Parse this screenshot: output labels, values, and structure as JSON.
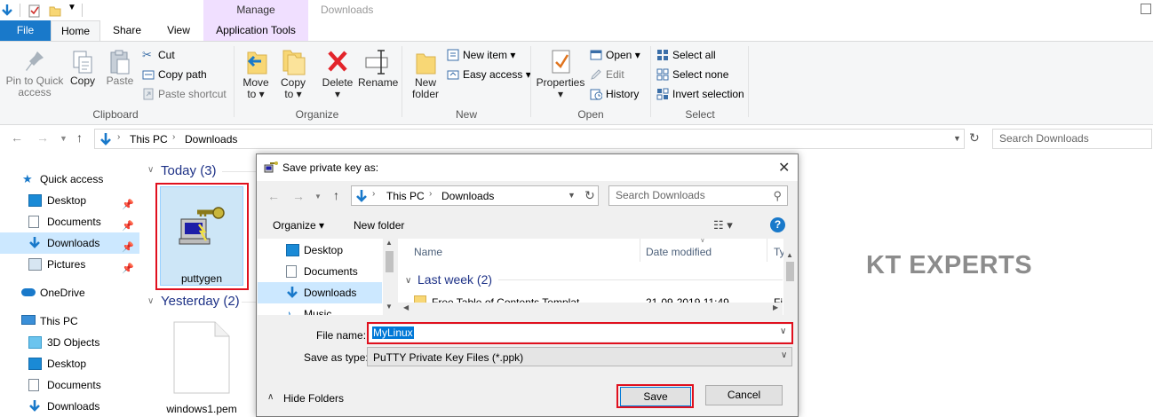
{
  "window": {
    "title": "Downloads",
    "contextual_tab_group": "Manage"
  },
  "tabs": {
    "file": "File",
    "home": "Home",
    "share": "Share",
    "view": "View",
    "app_tools": "Application Tools"
  },
  "ribbon": {
    "clipboard": {
      "group_label": "Clipboard",
      "pin_line1": "Pin to Quick",
      "pin_line2": "access",
      "copy": "Copy",
      "paste": "Paste",
      "cut": "Cut",
      "copy_path": "Copy path",
      "paste_shortcut": "Paste shortcut"
    },
    "organize": {
      "group_label": "Organize",
      "move_line1": "Move",
      "move_line2": "to ▾",
      "copy_line1": "Copy",
      "copy_line2": "to ▾",
      "delete_line1": "Delete",
      "delete_line2": "▾",
      "rename": "Rename"
    },
    "new": {
      "group_label": "New",
      "new_folder_line1": "New",
      "new_folder_line2": "folder",
      "new_item": "New item ▾",
      "easy_access": "Easy access ▾"
    },
    "open": {
      "group_label": "Open",
      "properties_line1": "Properties",
      "properties_line2": "▾",
      "open": "Open ▾",
      "edit": "Edit",
      "history": "History"
    },
    "select": {
      "group_label": "Select",
      "select_all": "Select all",
      "select_none": "Select none",
      "invert_selection": "Invert selection"
    }
  },
  "address": {
    "crumbs": [
      "This PC",
      "Downloads"
    ],
    "search_placeholder": "Search Downloads"
  },
  "nav": {
    "quick_access": "Quick access",
    "items": [
      "Desktop",
      "Documents",
      "Downloads",
      "Pictures"
    ],
    "onedrive": "OneDrive",
    "this_pc": "This PC",
    "pc_items": [
      "3D Objects",
      "Desktop",
      "Documents",
      "Downloads"
    ]
  },
  "content": {
    "group_today": "Today (3)",
    "group_yesterday": "Yesterday (2)",
    "file_puttygen": "puttygen",
    "file_windows1": "windows1.pem"
  },
  "watermark": "KT EXPERTS",
  "dialog": {
    "title": "Save private key as:",
    "crumbs": [
      "This PC",
      "Downloads"
    ],
    "search_placeholder": "Search Downloads",
    "organize": "Organize ▾",
    "new_folder": "New folder",
    "nav_items": [
      "Desktop",
      "Documents",
      "Downloads",
      "Music"
    ],
    "columns": [
      "Name",
      "Date modified",
      "Ty"
    ],
    "group_last_week": "Last week (2)",
    "row_partial_name": "Free Table of Contents Templat...",
    "row_partial_date": "21-09-2019 11:49",
    "row_partial_type": "Fi",
    "file_name_label": "File name:",
    "file_name_value": "MyLinux",
    "save_as_type_label": "Save as type:",
    "save_as_type_value": "PuTTY Private Key Files (*.ppk)",
    "hide_folders": "Hide Folders",
    "save": "Save",
    "cancel": "Cancel",
    "help": "?"
  },
  "colors": {
    "accent_blue": "#1979ca",
    "manage_band": "#f0dfff",
    "highlight_red": "#e0101e",
    "group_header_blue": "#1e3287",
    "selection_blue": "#0078d7"
  }
}
